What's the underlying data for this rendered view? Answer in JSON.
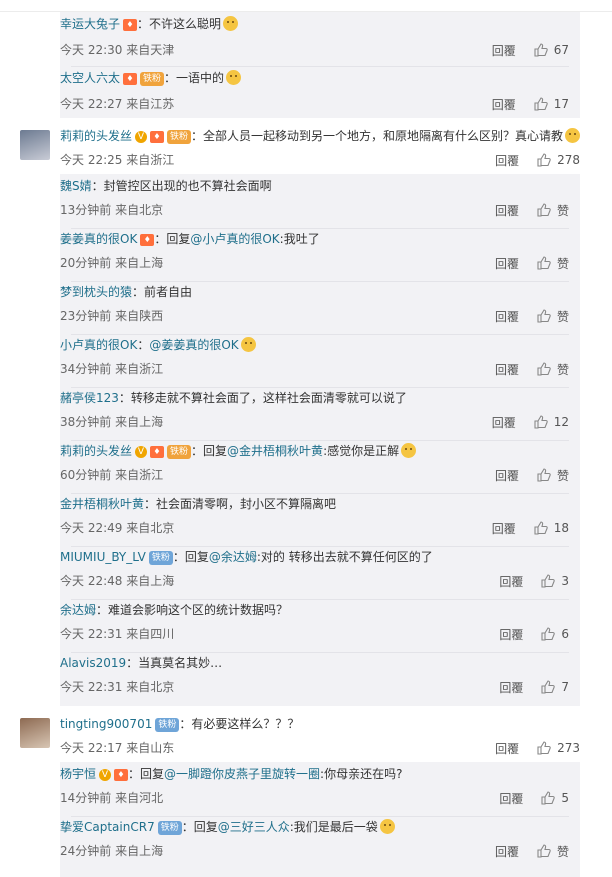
{
  "reply_label": "回覆",
  "top_replies": [
    {
      "user": "幸运大兔子",
      "lv": true,
      "badge": "",
      "text": "：不许这么聪明",
      "emoji": true,
      "time": "今天 22:30 来自天津",
      "likes": "67"
    },
    {
      "user": "太空人六太",
      "lv": true,
      "badge": "铁粉",
      "text": "：一语中的",
      "emoji": true,
      "time": "今天 22:27 来自江苏",
      "likes": "17"
    }
  ],
  "comment1": {
    "user": "莉莉的头发丝",
    "text": "：全部人员一起移动到另一个地方，和原地隔离有什么区别？真心请教",
    "badge": "铁粉",
    "time": "今天 22:25 来自浙江",
    "likes": "278"
  },
  "sub_replies_1": [
    {
      "user": "魏S婧",
      "lv": false,
      "badge": "",
      "text": "：封管控区出现的也不算社会面啊",
      "emoji": false,
      "time": "13分钟前 来自北京",
      "likes": "赞"
    },
    {
      "user": "姜姜真的很OK",
      "lv": true,
      "badge": "",
      "text": "：回复",
      "mention": "@小卢真的很OK",
      "tail": ":我吐了",
      "emoji": false,
      "time": "20分钟前 来自上海",
      "likes": "赞"
    },
    {
      "user": "梦到枕头的猿",
      "lv": false,
      "badge": "",
      "text": "：前者自由",
      "emoji": false,
      "time": "23分钟前 来自陕西",
      "likes": "赞"
    },
    {
      "user": "小卢真的很OK",
      "lv": false,
      "badge": "",
      "text": "：",
      "mention": "@姜姜真的很OK",
      "tail": "",
      "emoji": true,
      "time": "34分钟前 来自浙江",
      "likes": "赞"
    },
    {
      "user": "赭亭侯123",
      "lv": false,
      "badge": "",
      "text": "：转移走就不算社会面了，这样社会面清零就可以说了",
      "emoji": false,
      "time": "38分钟前 来自上海",
      "likes": "12"
    },
    {
      "user": "莉莉的头发丝",
      "lv": true,
      "badge": "铁粉",
      "text": "：回复",
      "mention": "@金井梧桐秋叶黄",
      "tail": ":感觉你是正解",
      "emoji": true,
      "vip": true,
      "time": "60分钟前 来自浙江",
      "likes": "赞"
    },
    {
      "user": "金井梧桐秋叶黄",
      "lv": false,
      "badge": "",
      "text": "：社会面清零啊，封小区不算隔离吧",
      "emoji": false,
      "time": "今天 22:49 来自北京",
      "likes": "18"
    },
    {
      "user": "MIUMIU_BY_LV",
      "lv": false,
      "badge": "铁粉",
      "text": "：回复",
      "mention": "@余达姆",
      "tail": ":对的 转移出去就不算任何区的了",
      "emoji": false,
      "time": "今天 22:48 来自上海",
      "likes": "3"
    },
    {
      "user": "余达姆",
      "lv": false,
      "badge": "",
      "text": "：难道会影响这个区的统计数据吗？",
      "emoji": false,
      "time": "今天 22:31 来自四川",
      "likes": "6"
    },
    {
      "user": "Alavis2019",
      "lv": false,
      "badge": "",
      "text": "：当真莫名其妙…",
      "emoji": false,
      "time": "今天 22:31 来自北京",
      "likes": "7"
    }
  ],
  "comment2": {
    "user": "tingting900701",
    "badge": "铁粉",
    "text": "：有必要这样么？？？",
    "time": "今天 22:17 来自山东",
    "likes": "273"
  },
  "sub_replies_2": [
    {
      "user": "杨宇恒",
      "lv": true,
      "badge": "",
      "vip": true,
      "text": "：回复",
      "mention": "@一脚蹬你皮燕子里旋转一圈",
      "tail": ":你母亲还在吗?",
      "emoji": false,
      "time": "14分钟前 来自河北",
      "likes": "5"
    },
    {
      "user": "挚爱CaptainCR7",
      "lv": false,
      "badge": "铁粉",
      "text": "：回复",
      "mention": "@三好三人众",
      "tail": ":我们是最后一袋",
      "emoji": true,
      "time": "24分钟前 来自上海",
      "likes": "赞"
    }
  ],
  "colors": {
    "link": "#1f6f8b",
    "bg_sub": "#f2f2f5",
    "badge_blue": "#6fa5d8"
  }
}
